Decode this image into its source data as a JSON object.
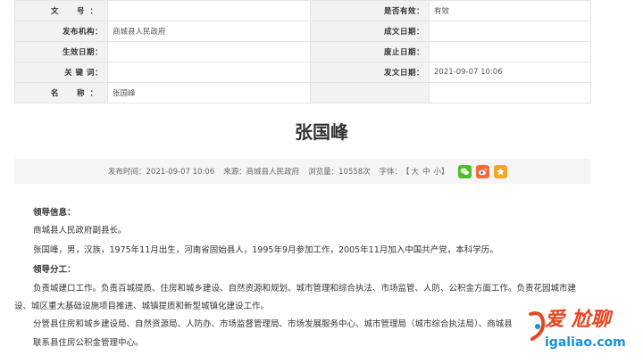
{
  "meta": {
    "rows": [
      {
        "label1": "文　号：",
        "value1": "",
        "label2": "是否有效：",
        "value2": "有效"
      },
      {
        "label1": "发布机构：",
        "value1": "商城县人民政府",
        "label2": "成文日期：",
        "value2": ""
      },
      {
        "label1": "生效日期：",
        "value1": "",
        "label2": "废止日期：",
        "value2": ""
      },
      {
        "label1": "关 键 词：",
        "value1": "",
        "label2": "发文日期：",
        "value2": "2021-09-07 10:06"
      },
      {
        "label1": "名　称：",
        "value1": "张国峰",
        "label2": "",
        "value2": ""
      }
    ]
  },
  "title": "张国峰",
  "info": {
    "publish_time": "发布时间：2021-09-07 10:06",
    "source": "来源：商城县人民政府",
    "views": "浏览量：10558次",
    "font_label": "字体：",
    "bracket_open": "【",
    "font_large": "大",
    "font_medium": "中",
    "font_small": "小",
    "bracket_close": "】",
    "share_icons": [
      "wechat-icon",
      "weibo-icon",
      "favorite-icon"
    ]
  },
  "body": {
    "leader_info_heading": "领导信息：",
    "position": "商城县人民政府副县长。",
    "bio": "张国峰，男，汉族，1975年11月出生，河南省固始县人，1995年9月参加工作，2005年11月加入中国共产党，本科学历。",
    "division_heading": "领导分工：",
    "duty_line1": "负责城建口工作。负责百城提质、住房和城乡建设、自然资源和规划、城市管理和综合执法、市场监管、人防、公积金方面工作。负责花园城市建",
    "duty_line2": "设、城区重大基础设施项目推进、城镇提质和新型城镇化建设工作。",
    "duty_line3": "分管县住房和城乡建设局、自然资源局、人防办、市场监督管理局、市场发展服务中心、城市管理局（城市综合执法局）、商城县",
    "duty_line4": "联系县住房公积金管理中心。"
  },
  "watermark": {
    "top_text": "爱 尬聊",
    "bottom_text": "igaliao.com"
  },
  "colors": {
    "wechat": "#4cbf2a",
    "weibo": "#f06a3b",
    "favorite": "#f5a623",
    "watermark_red": "#e8451e",
    "watermark_blue": "#1d8fd6"
  }
}
